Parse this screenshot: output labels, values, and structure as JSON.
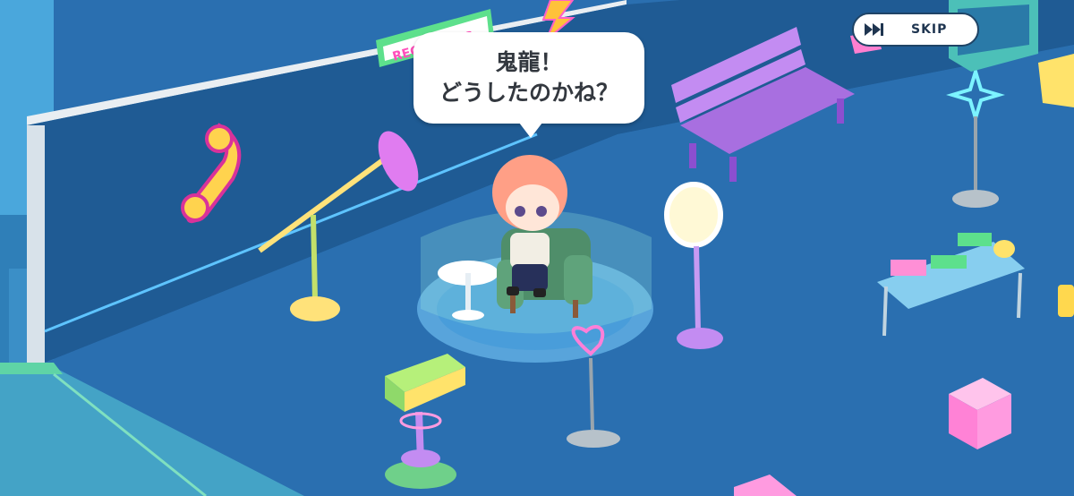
{
  "dialogue": {
    "line1": "鬼龍！",
    "line2": "どうしたのかね？"
  },
  "skip_button": {
    "label": "SKIP",
    "icon": "fast-forward-icon"
  },
  "sign": {
    "text": "RECORDING"
  },
  "colors": {
    "floor": "#2a6fb0",
    "wall": "#1f5c96",
    "accent_pink": "#ff5fc7",
    "accent_green": "#5de08c"
  }
}
